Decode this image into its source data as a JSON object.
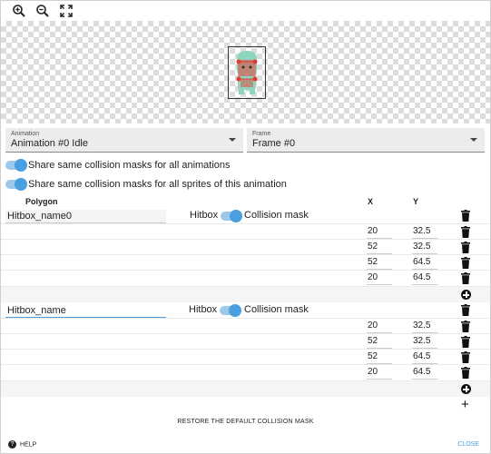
{
  "toolbar": {
    "zoom_in_icon": "zoom-in-icon",
    "zoom_out_icon": "zoom-out-icon",
    "fit_icon": "fit-icon"
  },
  "animation_select": {
    "label": "Animation",
    "value": "Animation #0 Idle"
  },
  "frame_select": {
    "label": "Frame",
    "value": "Frame #0"
  },
  "toggles": [
    {
      "label": "Share same collision masks for all animations",
      "on": true
    },
    {
      "label": "Share same collision masks for all sprites of this animation",
      "on": true
    }
  ],
  "headers": {
    "polygon": "Polygon",
    "x": "X",
    "y": "Y"
  },
  "polygons": [
    {
      "name": "Hitbox_name0",
      "hitbox_label": "Hitbox",
      "collision_label": "Collision mask",
      "vertices": [
        {
          "x": "20",
          "y": "32.5"
        },
        {
          "x": "52",
          "y": "32.5"
        },
        {
          "x": "52",
          "y": "64.5"
        },
        {
          "x": "20",
          "y": "64.5"
        }
      ]
    },
    {
      "name": "Hitbox_name",
      "hitbox_label": "Hitbox",
      "collision_label": "Collision mask",
      "vertices": [
        {
          "x": "20",
          "y": "32.5"
        },
        {
          "x": "52",
          "y": "32.5"
        },
        {
          "x": "52",
          "y": "64.5"
        },
        {
          "x": "20",
          "y": "64.5"
        }
      ]
    }
  ],
  "restore_label": "RESTORE THE DEFAULT COLLISION MASK",
  "help_label": "HELP",
  "close_label": "CLOSE",
  "colors": {
    "accent": "#4a9fe0",
    "vertex": "#e53935"
  }
}
